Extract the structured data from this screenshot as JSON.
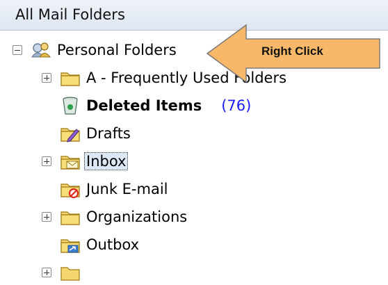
{
  "header": {
    "title": "All Mail Folders"
  },
  "tree": [
    {
      "label": "Personal Folders",
      "icon": "personal-folders-icon",
      "expander": "minus",
      "bold": false
    },
    {
      "label": "A - Frequently Used Folders",
      "icon": "folder-icon",
      "expander": "plus",
      "bold": false
    },
    {
      "label": "Deleted Items",
      "icon": "recycle-bin-icon",
      "expander": "none",
      "bold": true,
      "count": "(76)"
    },
    {
      "label": "Drafts",
      "icon": "drafts-folder-icon",
      "expander": "none",
      "bold": false
    },
    {
      "label": "Inbox",
      "icon": "inbox-folder-icon",
      "expander": "plus",
      "bold": false,
      "selected": true
    },
    {
      "label": "Junk E-mail",
      "icon": "junk-folder-icon",
      "expander": "none",
      "bold": false
    },
    {
      "label": "Organizations",
      "icon": "folder-icon",
      "expander": "plus",
      "bold": false
    },
    {
      "label": "Outbox",
      "icon": "outbox-folder-icon",
      "expander": "none",
      "bold": false
    }
  ],
  "callout": {
    "text": "Right Click",
    "color": "#f8b86a"
  },
  "colors": {
    "count": "#1a1aff",
    "folder": "#f2c94c",
    "header": "#e4eaf4"
  }
}
